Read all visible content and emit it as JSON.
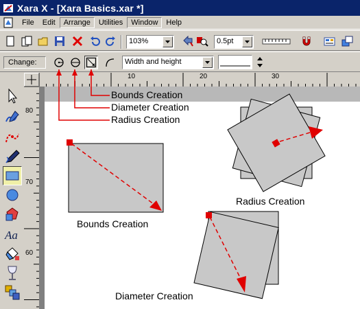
{
  "window": {
    "title": "Xara X - [Xara Basics.xar *]"
  },
  "menu": {
    "items": [
      "File",
      "Edit",
      "Arrange",
      "Utilities",
      "Window",
      "Help"
    ]
  },
  "toolbar": {
    "zoom_value": "103%",
    "line_width_value": "0.5pt"
  },
  "infobar": {
    "change_label": "Change:",
    "resize_mode_value": "Width and height"
  },
  "rulers": {
    "horizontal_ticks": [
      "10",
      "20",
      "30"
    ],
    "vertical_ticks": [
      "80",
      "70",
      "60"
    ]
  },
  "callouts": {
    "bounds": "Bounds Creation",
    "diameter": "Diameter Creation",
    "radius": "Radius Creation"
  },
  "examples": {
    "bounds_caption": "Bounds Creation",
    "radius_caption": "Radius Creation",
    "diameter_caption": "Diameter Creation"
  },
  "colors": {
    "title_bar": "#0a246a",
    "callout_red": "#e00000",
    "shape_fill": "#c8c8c8",
    "active_tool": "#f0f0a8"
  }
}
